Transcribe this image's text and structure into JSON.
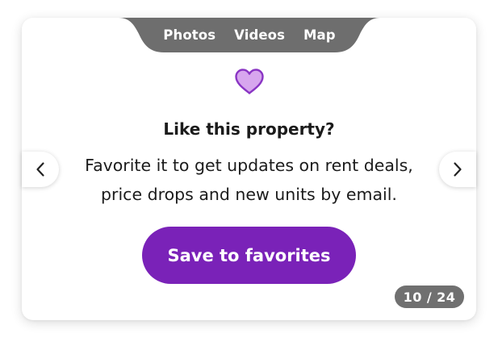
{
  "tabs": [
    {
      "label": "Photos"
    },
    {
      "label": "Videos"
    },
    {
      "label": "Map"
    }
  ],
  "card": {
    "title": "Like this property?",
    "description_line1": "Favorite it to get updates on rent deals,",
    "description_line2": "price drops and new units by email.",
    "save_label": "Save to favorites",
    "favorite_icon": "heart-icon",
    "prev_icon": "chevron-left-icon",
    "next_icon": "chevron-right-icon"
  },
  "counter": {
    "current": "10",
    "separator": "/",
    "total": "24"
  },
  "colors": {
    "accent": "#7a22b8",
    "heart_fill": "#d7a6ee",
    "tabbar": "#6e6e6e",
    "counter_bg": "#707070"
  }
}
